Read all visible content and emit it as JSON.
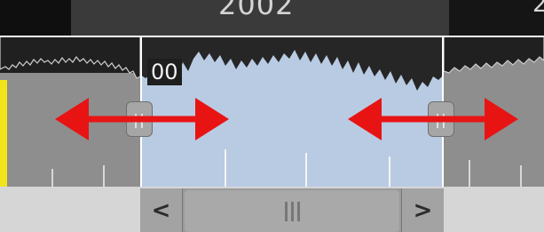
{
  "timeline": {
    "year_label": "2002",
    "next_year_label_fragment": "2",
    "selection_time_label": "00",
    "left_handle_grip": "||",
    "right_handle_grip": "||"
  },
  "scrollbar": {
    "left_button": "<",
    "right_button": ">"
  },
  "annotations": {
    "arrow_color": "#e81414",
    "arrow_count": 2
  },
  "colors": {
    "selection_fill": "#b9cbe3",
    "outside_fill": "#8e8e8e",
    "marker_yellow": "#f2e41a"
  },
  "icons": [
    "double-arrow-left-icon",
    "double-arrow-right-icon",
    "grip-icon",
    "chevron-left-icon",
    "chevron-right-icon"
  ]
}
